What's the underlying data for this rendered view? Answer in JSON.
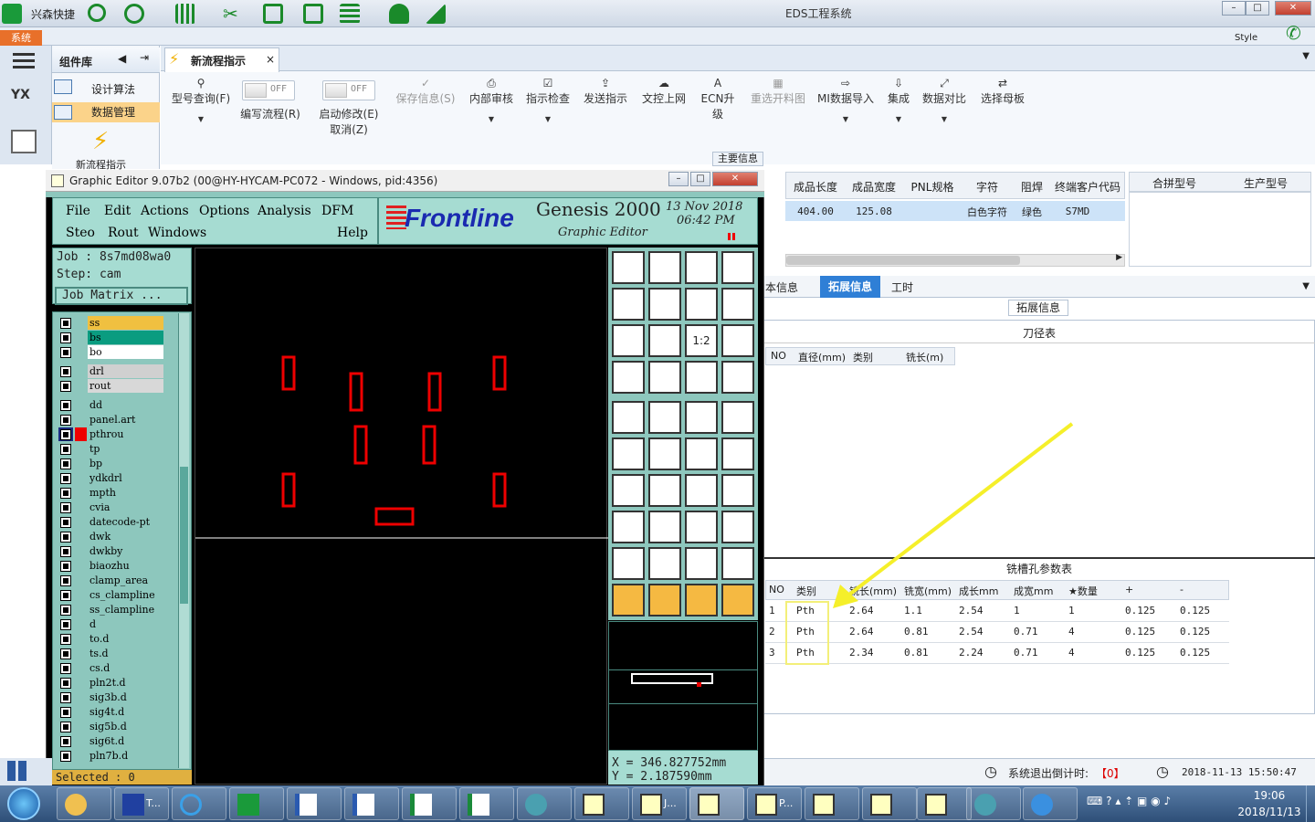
{
  "window": {
    "title": "EDS工程系统",
    "company": "兴森快捷",
    "style_label": "Style",
    "system_tab": "系统"
  },
  "components": {
    "header": "组件库",
    "items": [
      "设计算法",
      "数据管理",
      "新流程指示"
    ]
  },
  "left_nav": {
    "logo": "YX"
  },
  "ribbon": {
    "active_tab": "新流程指示",
    "toggle_off": "OFF",
    "buttons": [
      "型号查询(F)",
      "编写流程(R)",
      "启动修改(E)",
      "取消(Z)",
      "保存信息(S)",
      "内部审核",
      "指示检查",
      "发送指示",
      "文控上网",
      "ECN升级",
      "重选开料图",
      "MI数据导入",
      "集成",
      "数据对比",
      "选择母板"
    ],
    "group_label": "主要信息"
  },
  "main_table": {
    "headers": [
      "成品长度",
      "成品宽度",
      "PNL规格",
      "字符",
      "阻焊",
      "终端客户代码",
      "合拼型号",
      "生产型号"
    ],
    "row": [
      "404.00",
      "125.08",
      "",
      "白色字符",
      "绿色",
      "S7MD"
    ]
  },
  "detail_tabs": {
    "tabs": [
      "本信息",
      "拓展信息",
      "工时"
    ],
    "active": "拓展信息",
    "section": "拓展信息"
  },
  "tool_table": {
    "title": "刀径表",
    "headers": [
      "NO",
      "直径(mm)",
      "类别",
      "铣长(m)"
    ]
  },
  "slot_table": {
    "title": "铣槽孔参数表",
    "headers": [
      "NO",
      "类别",
      "铣长(mm)",
      "铣宽(mm)",
      "成长mm",
      "成宽mm",
      "★数量",
      "+",
      "-"
    ],
    "rows": [
      [
        "1",
        "Pth",
        "2.64",
        "1.1",
        "2.54",
        "1",
        "1",
        "0.125",
        "0.125"
      ],
      [
        "2",
        "Pth",
        "2.64",
        "0.81",
        "2.54",
        "0.71",
        "4",
        "0.125",
        "0.125"
      ],
      [
        "3",
        "Pth",
        "2.34",
        "0.81",
        "2.24",
        "0.71",
        "4",
        "0.125",
        "0.125"
      ]
    ]
  },
  "status_bar": {
    "countdown_label": "系统退出倒计时:",
    "countdown_value": "【0】",
    "datetime": "2018-11-13 15:50:47"
  },
  "genesis": {
    "title": "Graphic Editor 9.07b2 (00@HY-HYCAM-PC072 - Windows, pid:4356)",
    "menu": [
      "File",
      "Edit",
      "Actions",
      "Options",
      "Analysis",
      "DFM",
      "Steo",
      "Rout",
      "Windows",
      "Help"
    ],
    "brand": "Frontline",
    "product": "Genesis 2000",
    "subtitle": "Graphic Editor",
    "date": "13 Nov 2018",
    "time": "06:42 PM",
    "job": "Job : 8s7md08wa0",
    "step": "Step: cam",
    "job_matrix": "Job Matrix ...",
    "layers": [
      "ss",
      "bs",
      "bo",
      "drl",
      "rout",
      "dd",
      "panel.art",
      "pthrou",
      "tp",
      "bp",
      "ydkdrl",
      "mpth",
      "cvia",
      "datecode-pt",
      "dwk",
      "dwkby",
      "biaozhu",
      "clamp_area",
      "cs_clampline",
      "ss_clampline",
      "d",
      "to.d",
      "ts.d",
      "cs.d",
      "pln2t.d",
      "sig3b.d",
      "sig4t.d",
      "sig5b.d",
      "sig6t.d",
      "pln7b.d"
    ],
    "layer_colors": {
      "ss": "#f0c040",
      "bs": "#0a9c80",
      "bo": "#ffffff",
      "drl": "#d0d0d0",
      "rout": "#d8d8d8"
    },
    "coords": {
      "x": "X = 346.827752mm",
      "y": "Y = 2.187590mm"
    },
    "selected": "Selected : 0",
    "tool_scale": "1:2"
  },
  "taskbar": {
    "time": "19:06",
    "date": "2018/11/13",
    "labels": [
      "T...",
      "J...",
      "P..."
    ]
  }
}
